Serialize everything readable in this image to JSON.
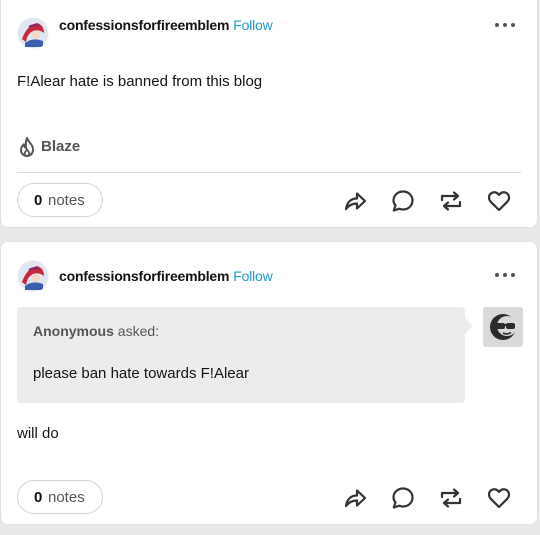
{
  "posts": [
    {
      "blog_name": "confessionsforfireemblem",
      "follow_label": "Follow",
      "body": "F!Alear hate is banned from this blog",
      "blaze_label": "Blaze",
      "notes_count": "0",
      "notes_label": "notes"
    },
    {
      "blog_name": "confessionsforfireemblem",
      "follow_label": "Follow",
      "ask": {
        "asker": "Anonymous",
        "asked_label": "asked:",
        "question": "please ban hate towards F!Alear"
      },
      "answer": "will do",
      "notes_count": "0",
      "notes_label": "notes"
    }
  ],
  "icons": {
    "more": "more-options-icon",
    "blaze": "flame-icon",
    "share": "share-icon",
    "reply": "reply-icon",
    "reblog": "reblog-icon",
    "like": "heart-icon"
  },
  "colors": {
    "accent": "#1d9bd1",
    "background": "#e9e9e9",
    "card": "#ffffff",
    "ask_background": "#ececec"
  }
}
